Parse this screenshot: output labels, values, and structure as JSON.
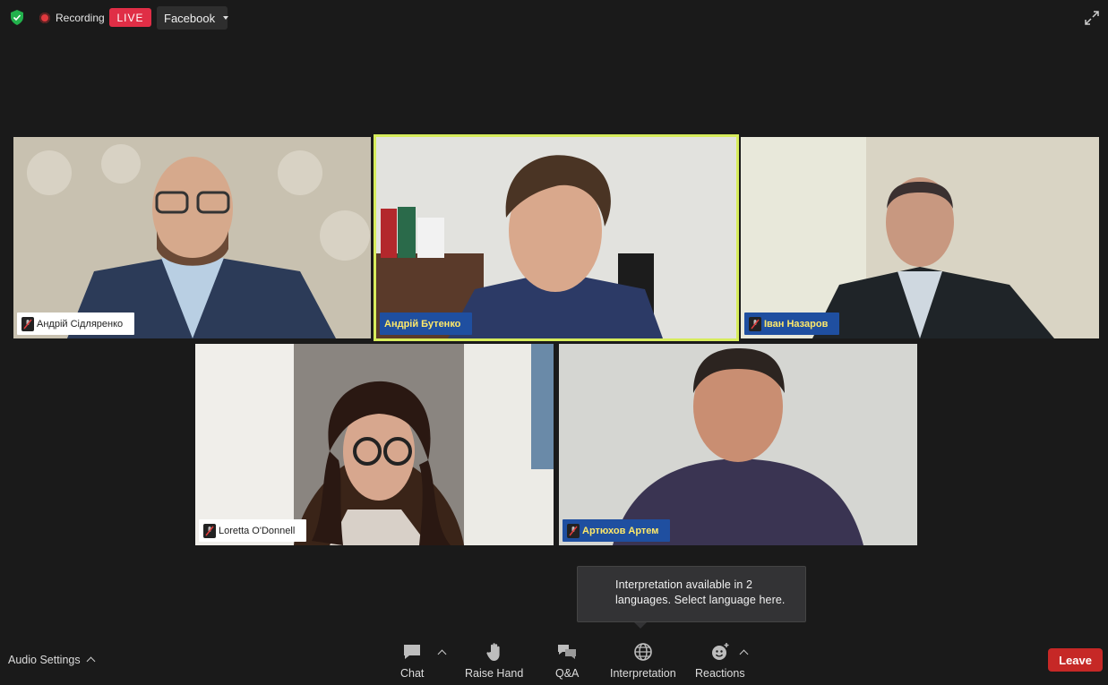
{
  "top_bar": {
    "recording_label": "Recording",
    "live_badge": "LIVE",
    "stream_target": "Facebook"
  },
  "participants": [
    {
      "name": "Андрій Сідляренко",
      "tag_style": "white",
      "muted": true
    },
    {
      "name": "Андрій Бутенко",
      "tag_style": "blue",
      "muted": false,
      "active_speaker": true
    },
    {
      "name": "Іван Назаров",
      "tag_style": "blue",
      "muted": true
    },
    {
      "name": "Loretta O'Donnell",
      "tag_style": "white",
      "muted": true
    },
    {
      "name": "Артюхов Артем",
      "tag_style": "blue",
      "muted": true
    }
  ],
  "tooltip": {
    "line1": "Interpretation available in 2",
    "line2": "languages. Select language here."
  },
  "toolbar": {
    "audio_settings": "Audio Settings",
    "chat": "Chat",
    "raise_hand": "Raise Hand",
    "qa": "Q&A",
    "interpretation": "Interpretation",
    "reactions": "Reactions",
    "leave": "Leave"
  },
  "colors": {
    "background": "#1a1a1a",
    "live": "#e02e46",
    "leave": "#c62826",
    "active_speaker_border": "#d7ec5c",
    "name_tag_blue": "#1f4fa0",
    "name_tag_text_yellow": "#ffe96a"
  }
}
